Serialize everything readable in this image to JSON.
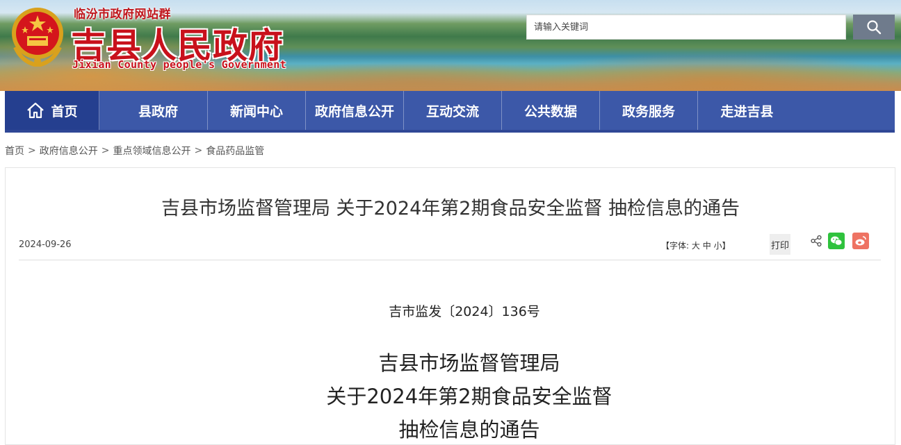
{
  "header": {
    "site_group": "临汾市政府网站群",
    "site_title": "吉县人民政府",
    "site_subtitle": "Jixian County people's Government",
    "emblem_icon": "national-emblem-icon",
    "search": {
      "placeholder": "请输入关键词",
      "button_icon": "search-icon"
    }
  },
  "nav": {
    "items": [
      {
        "label": "首页",
        "icon": "home-icon"
      },
      {
        "label": "县政府"
      },
      {
        "label": "新闻中心"
      },
      {
        "label": "政府信息公开"
      },
      {
        "label": "互动交流"
      },
      {
        "label": "公共数据"
      },
      {
        "label": "政务服务"
      },
      {
        "label": "走进吉县"
      }
    ],
    "colors": {
      "bar": "#3c58a8",
      "active": "#253f8f"
    }
  },
  "breadcrumb": [
    "首页",
    "政府信息公开",
    "重点领域信息公开",
    "食品药品监管"
  ],
  "article": {
    "title": "吉县市场监督管理局 关于2024年第2期食品安全监督 抽检信息的通告",
    "date": "2024-09-26",
    "font_size": {
      "prefix": "【字体:",
      "large": "大",
      "medium": "中",
      "small": "小",
      "suffix": "】"
    },
    "print_label": "打印",
    "share_icons": [
      "share-icon",
      "wechat-icon",
      "weibo-icon"
    ],
    "doc_number": "吉市监发〔2024〕136号",
    "body_title_lines": [
      "吉县市场监督管理局",
      "关于2024年第2期食品安全监督",
      "抽检信息的通告"
    ]
  }
}
